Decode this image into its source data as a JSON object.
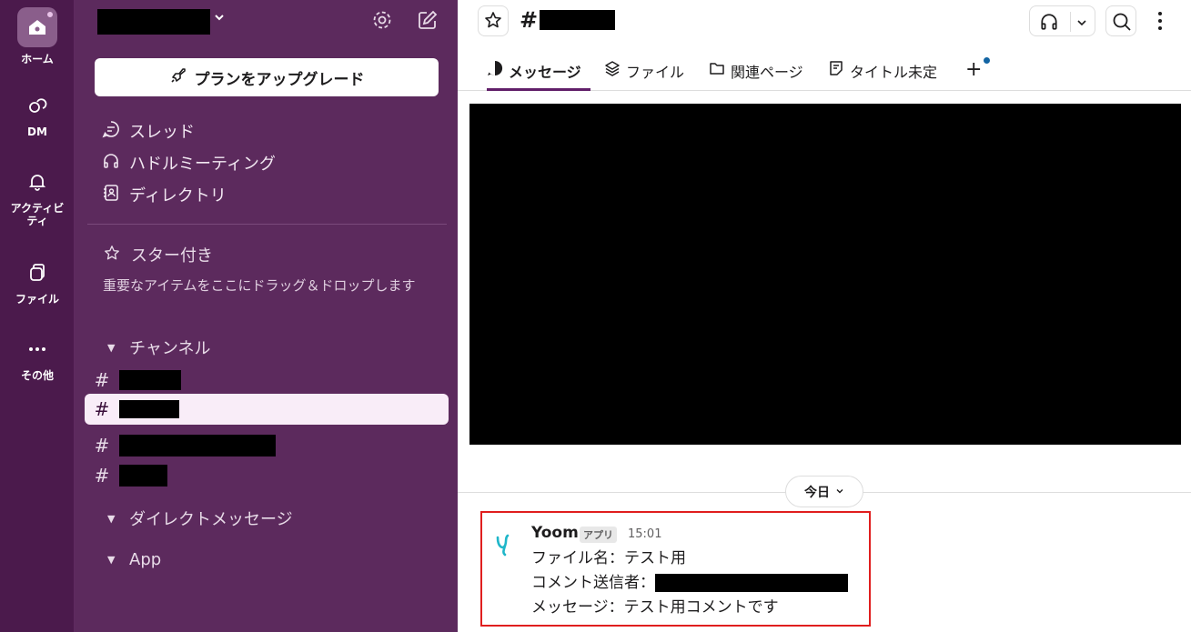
{
  "rail": {
    "items": [
      {
        "label": "ホーム",
        "icon": "home-icon"
      },
      {
        "label": "DM",
        "icon": "dm-icon"
      },
      {
        "label": "アクティビティ",
        "icon": "bell-icon"
      },
      {
        "label": "ファイル",
        "icon": "files-icon"
      },
      {
        "label": "その他",
        "icon": "more-icon"
      }
    ]
  },
  "sidebar": {
    "upgrade_label": "プランをアップグレード",
    "nav": [
      {
        "label": "スレッド",
        "icon": "threads-icon"
      },
      {
        "label": "ハドルミーティング",
        "icon": "headphones-icon"
      },
      {
        "label": "ディレクトリ",
        "icon": "directory-icon"
      }
    ],
    "starred": {
      "title": "スター付き",
      "hint": "重要なアイテムをここにドラッグ＆ドロップします"
    },
    "channels_title": "チャンネル",
    "channel_hash": "#",
    "dm_title": "ダイレクトメッセージ",
    "app_title": "App"
  },
  "header": {
    "hash": "#"
  },
  "tabs": [
    {
      "label": "メッセージ",
      "icon": "message-icon"
    },
    {
      "label": "ファイル",
      "icon": "layers-icon"
    },
    {
      "label": "関連ページ",
      "icon": "folder-icon"
    },
    {
      "label": "タイトル未定",
      "icon": "canvas-icon"
    }
  ],
  "tab_add": "+",
  "day_divider": "今日",
  "message": {
    "author": "Yoom",
    "badge": "アプリ",
    "time": "15:01",
    "line1": "ファイル名：テスト用",
    "line2": "コメント送信者：",
    "line3": "メッセージ：テスト用コメントです"
  },
  "colors": {
    "rail_bg": "#4b1a4c",
    "sidebar_bg": "#5c2a5d",
    "active_channel_bg": "#f9edf8",
    "highlight_border": "#e01e1e",
    "tab_underline": "#611f69"
  }
}
